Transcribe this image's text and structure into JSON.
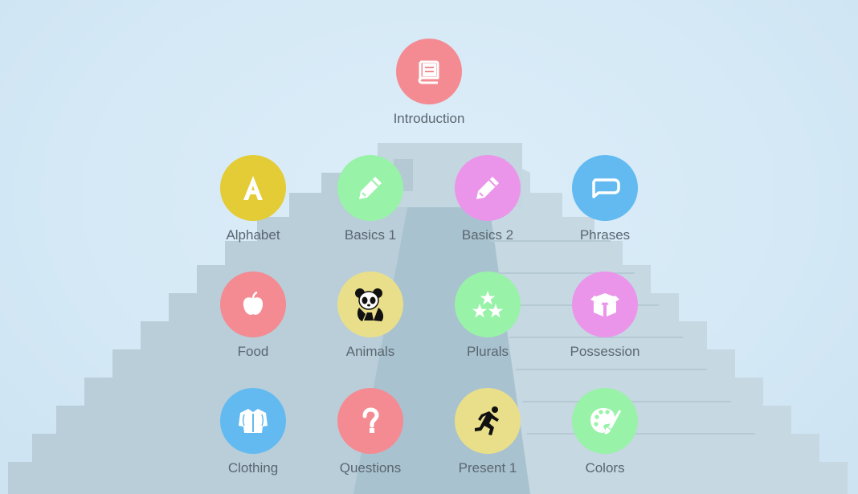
{
  "skills": [
    {
      "label": "Introduction",
      "icon": "book-icon",
      "color": "#f48b92"
    },
    {
      "label": "Alphabet",
      "icon": "letter-a-icon",
      "color": "#e3cc35"
    },
    {
      "label": "Basics 1",
      "icon": "pencil-icon",
      "color": "#98f2a8"
    },
    {
      "label": "Basics 2",
      "icon": "pencil-icon",
      "color": "#ea95ea"
    },
    {
      "label": "Phrases",
      "icon": "speech-bubble-icon",
      "color": "#62baf0"
    },
    {
      "label": "Food",
      "icon": "apple-icon",
      "color": "#f48b92"
    },
    {
      "label": "Animals",
      "icon": "panda-icon",
      "color": "#e9df8a"
    },
    {
      "label": "Plurals",
      "icon": "stars-icon",
      "color": "#98f2a8"
    },
    {
      "label": "Possession",
      "icon": "box-icon",
      "color": "#ea95ea"
    },
    {
      "label": "Clothing",
      "icon": "shirt-icon",
      "color": "#62baf0"
    },
    {
      "label": "Questions",
      "icon": "question-mark-icon",
      "color": "#f48b92"
    },
    {
      "label": "Present 1",
      "icon": "runner-icon",
      "color": "#e9df8a"
    },
    {
      "label": "Colors",
      "icon": "palette-icon",
      "color": "#98f2a8"
    }
  ]
}
